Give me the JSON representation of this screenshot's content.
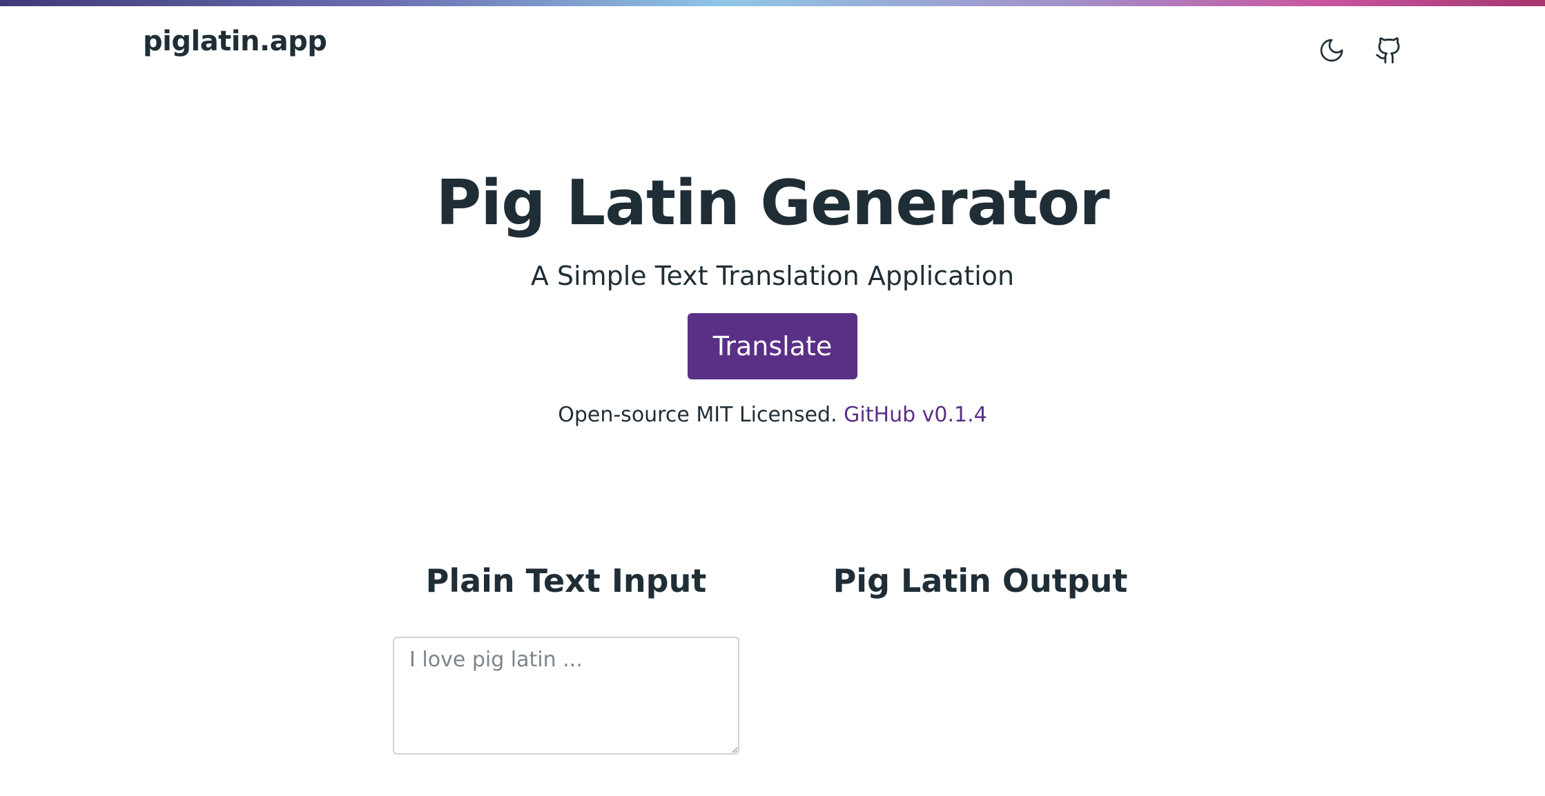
{
  "header": {
    "brand": "piglatin.app",
    "theme_toggle_icon": "moon-icon",
    "github_icon": "github-icon"
  },
  "hero": {
    "title": "Pig Latin Generator",
    "subtitle": "A Simple Text Translation Application",
    "translate_label": "Translate",
    "license_text": "Open-source MIT Licensed.",
    "github_link": "GitHub v0.1.4"
  },
  "translator": {
    "input_title": "Plain Text Input",
    "input_value": "",
    "input_placeholder": "I love pig latin ...",
    "output_title": "Pig Latin Output",
    "output_value": ""
  },
  "colors": {
    "accent": "#5a2f86",
    "text": "#1f2d36",
    "background": "#ffffff",
    "input_border": "#cfd3d6"
  }
}
